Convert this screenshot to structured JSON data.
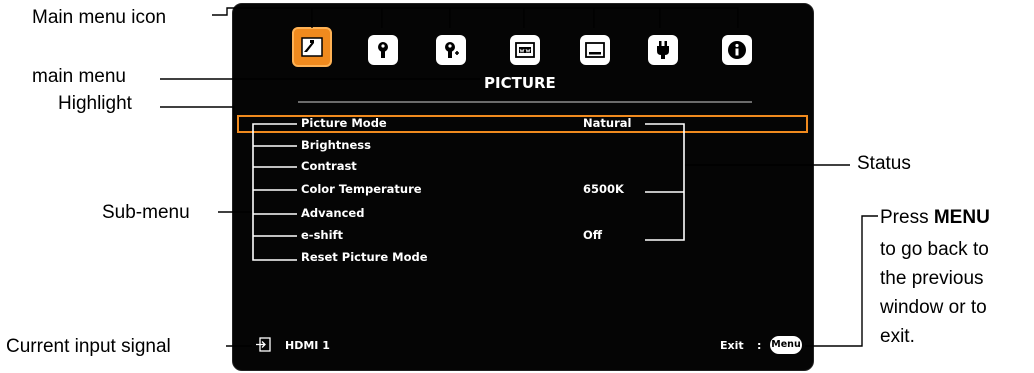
{
  "callouts": {
    "main_menu_icon": "Main menu icon",
    "main_menu": "main menu",
    "highlight": "Highlight",
    "sub_menu": "Sub-menu",
    "current_input": "Current input signal",
    "status": "Status",
    "press_prefix": "Press ",
    "press_key": "MENU",
    "press_line2": "to go back to",
    "press_line3": "the previous",
    "press_line4": "window or to",
    "press_line5": "exit."
  },
  "osd": {
    "title": "PICTURE",
    "tabs": [
      {
        "icon": "picture-icon",
        "selected": true
      },
      {
        "icon": "wrench-icon",
        "selected": false
      },
      {
        "icon": "wrench-plus-icon",
        "selected": false
      },
      {
        "icon": "display-setup-icon",
        "selected": false
      },
      {
        "icon": "screen-icon",
        "selected": false
      },
      {
        "icon": "power-plug-icon",
        "selected": false
      },
      {
        "icon": "info-icon",
        "selected": false
      }
    ],
    "items": [
      {
        "label": "Picture Mode",
        "value": "Natural"
      },
      {
        "label": "Brightness",
        "value": ""
      },
      {
        "label": "Contrast",
        "value": ""
      },
      {
        "label": "Color Temperature",
        "value": "6500K"
      },
      {
        "label": "Advanced",
        "value": ""
      },
      {
        "label": "e-shift",
        "value": "Off"
      },
      {
        "label": "Reset Picture Mode",
        "value": ""
      }
    ],
    "input_signal": "HDMI 1",
    "exit_label": "Exit",
    "exit_sep": ":",
    "menu_key": "Menu"
  },
  "colors": {
    "accent": "#f08a1e",
    "osd_background": "#050505",
    "text": "#ffffff"
  }
}
